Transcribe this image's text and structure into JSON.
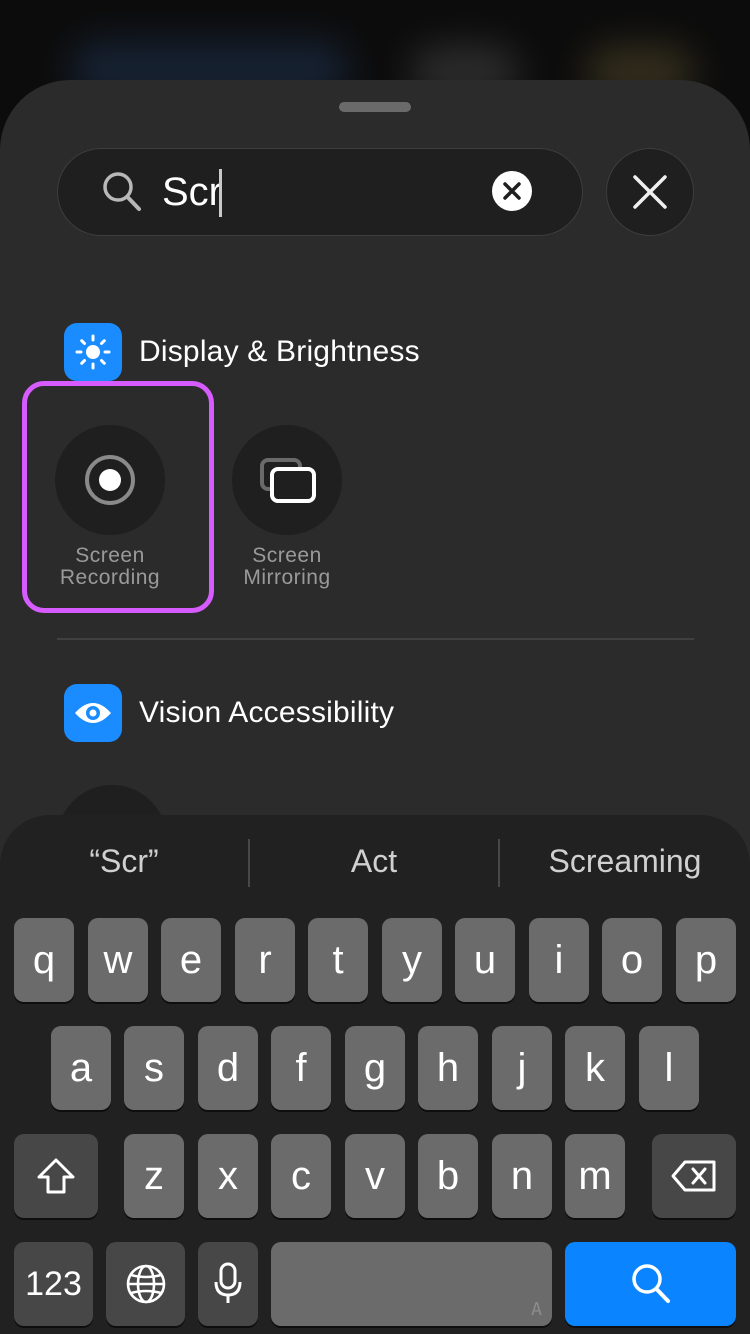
{
  "search": {
    "value": "Scr",
    "clear_icon": "clear-circle-icon",
    "close_icon": "close-icon"
  },
  "sections": [
    {
      "title": "Display & Brightness",
      "icon": "sun-icon",
      "color": "#1a8cff",
      "controls": [
        {
          "label_line1": "Screen",
          "label_line2": "Recording",
          "icon": "record-icon",
          "highlighted": true
        },
        {
          "label_line1": "Screen",
          "label_line2": "Mirroring",
          "icon": "screen-mirroring-icon"
        }
      ]
    },
    {
      "title": "Vision Accessibility",
      "icon": "eye-icon",
      "color": "#1a8cff"
    }
  ],
  "highlight_color": "#d75cff",
  "keyboard": {
    "suggestions": [
      "“Scr”",
      "Act",
      "Screaming"
    ],
    "row1": [
      "q",
      "w",
      "e",
      "r",
      "t",
      "y",
      "u",
      "i",
      "o",
      "p"
    ],
    "row2": [
      "a",
      "s",
      "d",
      "f",
      "g",
      "h",
      "j",
      "k",
      "l"
    ],
    "row3": [
      "z",
      "x",
      "c",
      "v",
      "b",
      "n",
      "m"
    ],
    "numbers_label": "123",
    "space_hint": "A",
    "search_key_icon": "search-icon",
    "accent": "#0a84ff"
  }
}
